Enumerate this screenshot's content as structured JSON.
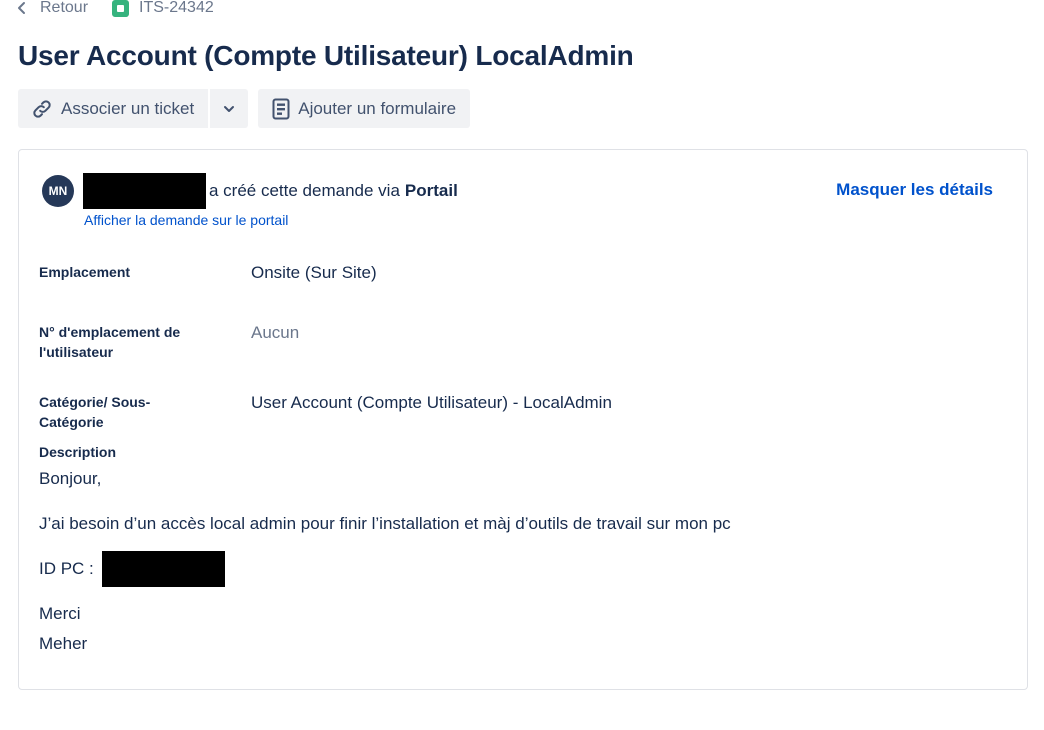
{
  "breadcrumb": {
    "back_label": "Retour",
    "ticket_key": "ITS-24342"
  },
  "title": "User Account (Compte Utilisateur) LocalAdmin",
  "toolbar": {
    "link_issue_label": "Associer un ticket",
    "add_form_label": "Ajouter un formulaire"
  },
  "request": {
    "avatar_initials": "MN",
    "created_text": "a créé cette demande via",
    "channel": "Portail",
    "view_on_portal_label": "Afficher la demande sur le portail",
    "hide_details_label": "Masquer les détails"
  },
  "fields": [
    {
      "label": "Emplacement",
      "value": "Onsite (Sur Site)"
    },
    {
      "label": "N° d'emplacement de l'utilisateur",
      "value": "Aucun"
    },
    {
      "label": "Catégorie/ Sous-Catégorie",
      "value": "User Account (Compte Utilisateur) - LocalAdmin"
    }
  ],
  "description": {
    "label": "Description",
    "greeting": "Bonjour,",
    "body": "J’ai besoin d’un accès local admin  pour finir l’installation  et màj d’outils de travail sur mon pc",
    "id_pc_label": "ID PC :",
    "thanks": "Merci",
    "signature": "Meher"
  },
  "colors": {
    "link": "#0052cc",
    "text": "#172b4d",
    "muted": "#6b778c",
    "button_bg": "#f1f2f4",
    "ticket_icon": "#36b37e",
    "avatar_bg": "#253858"
  },
  "icons": {
    "back": "chevron-left-icon",
    "ticket_type": "service-request-icon",
    "link": "link-icon",
    "dropdown": "chevron-down-icon",
    "form": "form-icon"
  }
}
